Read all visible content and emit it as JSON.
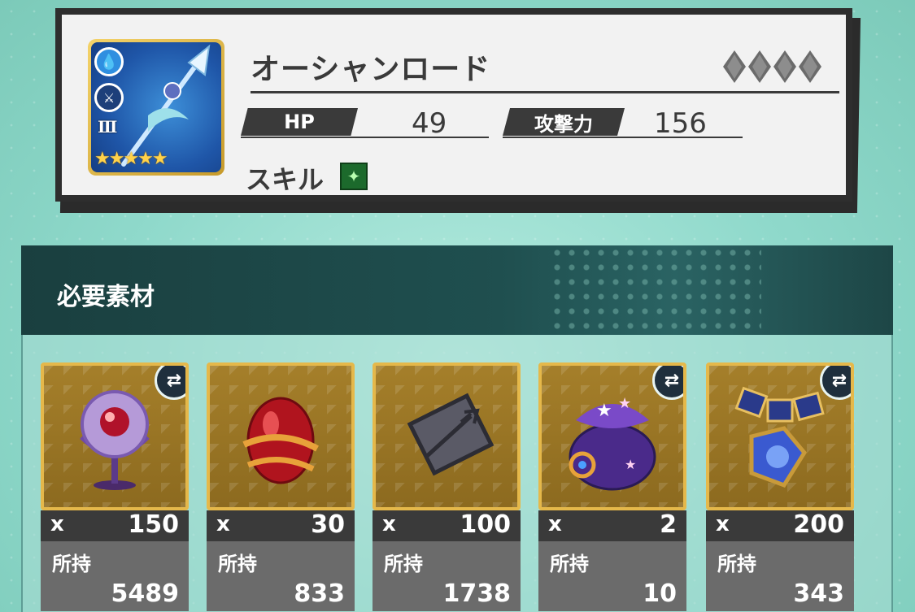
{
  "weapon": {
    "name": "オーシャンロード",
    "rank": "Ⅲ",
    "stars": "★★★★★",
    "element_icon": "water-drop-icon",
    "type_icon": "spear-icon",
    "hp_label": "HP",
    "hp_value": "49",
    "atk_label": "攻撃力",
    "atk_value": "156",
    "skill_label": "スキル"
  },
  "materials_panel": {
    "title": "必要素材",
    "prefix": "x",
    "owned_label": "所持",
    "items": [
      {
        "icon": "purple-orb-icon",
        "required": "150",
        "owned": "5489",
        "swap": true
      },
      {
        "icon": "red-egg-icon",
        "required": "30",
        "owned": "833",
        "swap": false
      },
      {
        "icon": "trident-plate-icon",
        "required": "100",
        "owned": "1738",
        "swap": false
      },
      {
        "icon": "star-pouch-icon",
        "required": "2",
        "owned": "10",
        "swap": true
      },
      {
        "icon": "blue-amulet-icon",
        "required": "200",
        "owned": "343",
        "swap": true
      }
    ]
  },
  "colors": {
    "frame_gold": "#e5b84a",
    "panel_dark": "#1a3f3f",
    "text_dark": "#3a3a3a"
  }
}
